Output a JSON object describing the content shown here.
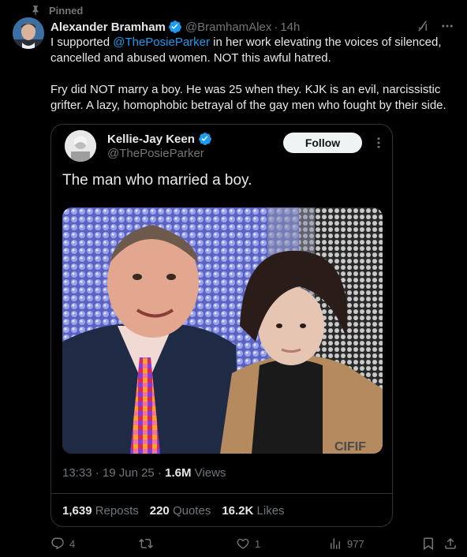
{
  "pinned_label": "Pinned",
  "author": {
    "name": "Alexander Bramham",
    "handle": "@BramhamAlex",
    "time": "14h",
    "avatar_icon": "profile-photo"
  },
  "tweet": {
    "line1_pre": "I supported ",
    "line1_mention": "@ThePosieParker",
    "line1_post": " in her work elevating the voices of silenced, cancelled and abused women. NOT this awful hatred.",
    "para2": "Fry did NOT marry a boy. He was 25 when they. KJK is an evil, narcissistic grifter. A lazy, homophobic betrayal of the gay men who fought by their side."
  },
  "quote": {
    "name": "Kellie-Jay Keen",
    "handle": "@ThePosieParker",
    "follow_label": "Follow",
    "text": "The man who married a boy.",
    "time": "13:33",
    "date": "19 Jun 25",
    "views_count": "1.6M",
    "views_label": "Views",
    "reposts_count": "1,639",
    "reposts_label": "Reposts",
    "quotes_count": "220",
    "quotes_label": "Quotes",
    "likes_count": "16.2K",
    "likes_label": "Likes",
    "photo_text": "CIFIF"
  },
  "actions": {
    "replies": "4",
    "reposts": "",
    "likes": "1",
    "views": "977"
  },
  "colors": {
    "accent": "#1d9bf0",
    "muted": "#71767b",
    "border": "#2f3336",
    "background": "#000000"
  }
}
